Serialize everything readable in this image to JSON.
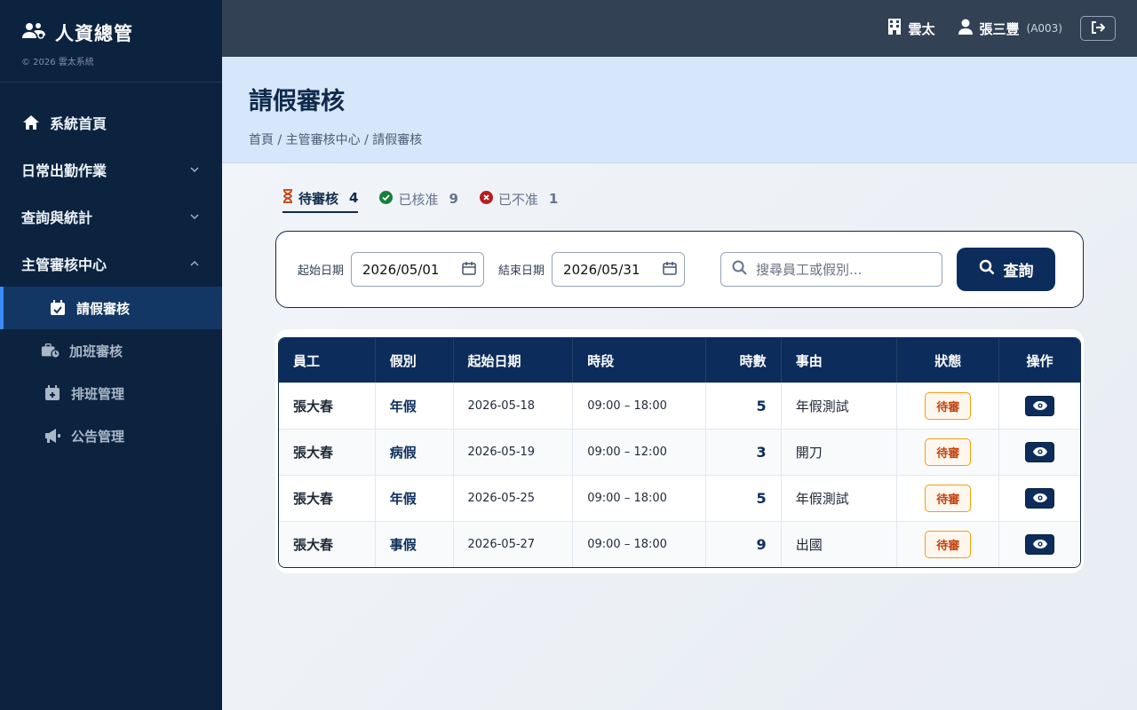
{
  "brand": {
    "title": "人資總管",
    "copyright": "© 2026 雲太系統"
  },
  "sidebar": {
    "items": [
      {
        "label": "系統首頁",
        "icon": "home-icon"
      },
      {
        "label": "日常出勤作業",
        "icon": "chevron-down-icon"
      },
      {
        "label": "查詢與統計",
        "icon": "chevron-down-icon"
      },
      {
        "label": "主管審核中心",
        "icon": "chevron-up-icon"
      }
    ],
    "sub_items": [
      {
        "label": "請假審核",
        "icon": "calendar-check-icon",
        "active": true
      },
      {
        "label": "加班審核",
        "icon": "briefcase-clock-icon"
      },
      {
        "label": "排班管理",
        "icon": "calendar-plus-icon"
      },
      {
        "label": "公告管理",
        "icon": "megaphone-icon"
      }
    ]
  },
  "topbar": {
    "company": "雲太",
    "user_name": "張三豐",
    "user_id": "(A003)"
  },
  "header": {
    "title": "請假審核",
    "breadcrumb": "首頁 / 主管審核中心 / 請假審核"
  },
  "tabs": [
    {
      "label": "待審核",
      "count": "4",
      "icon": "hourglass-icon",
      "active": true
    },
    {
      "label": "已核准",
      "count": "9",
      "icon": "check-circle-icon"
    },
    {
      "label": "已不准",
      "count": "1",
      "icon": "x-circle-icon"
    }
  ],
  "filter": {
    "start_label": "起始日期",
    "start_value": "2026/05/01",
    "end_label": "結束日期",
    "end_value": "2026/05/31",
    "search_placeholder": "搜尋員工或假別...",
    "query_label": "查詢"
  },
  "table": {
    "headers": [
      "員工",
      "假別",
      "起始日期",
      "時段",
      "時數",
      "事由",
      "狀態",
      "操作"
    ],
    "rows": [
      {
        "employee": "張大春",
        "type": "年假",
        "start": "2026-05-18",
        "period": "09:00 – 18:00",
        "hours": "5",
        "reason": "年假測試",
        "status": "待審"
      },
      {
        "employee": "張大春",
        "type": "病假",
        "start": "2026-05-19",
        "period": "09:00 – 12:00",
        "hours": "3",
        "reason": "開刀",
        "status": "待審"
      },
      {
        "employee": "張大春",
        "type": "年假",
        "start": "2026-05-25",
        "period": "09:00 – 18:00",
        "hours": "5",
        "reason": "年假測試",
        "status": "待審"
      },
      {
        "employee": "張大春",
        "type": "事假",
        "start": "2026-05-27",
        "period": "09:00 – 18:00",
        "hours": "9",
        "reason": "出國",
        "status": "待審"
      }
    ]
  },
  "colors": {
    "sidebar_bg": "#0c2340",
    "accent": "#0c2d5c",
    "active_border": "#3d8bff",
    "pending": "#c2410c",
    "approved": "#15803d",
    "rejected": "#b91c1c"
  }
}
